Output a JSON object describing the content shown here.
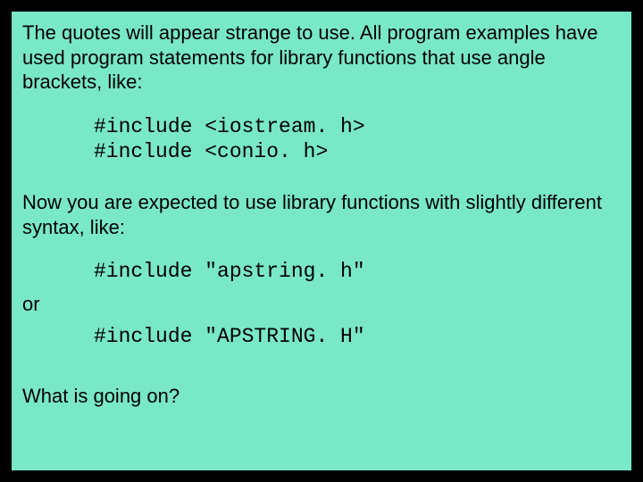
{
  "para1": "The quotes will appear strange to use.  All program examples have used program statements for library functions that use angle brackets, like:",
  "code1_line1": "#include <iostream. h>",
  "code1_line2": "#include <conio. h>",
  "para2": "Now you are expected to use library functions with slightly different syntax, like:",
  "code2_line1": "#include \"apstring. h\"",
  "or_label": "or",
  "code2_line2": "#include \"APSTRING. H\"",
  "final": "What is going on?"
}
